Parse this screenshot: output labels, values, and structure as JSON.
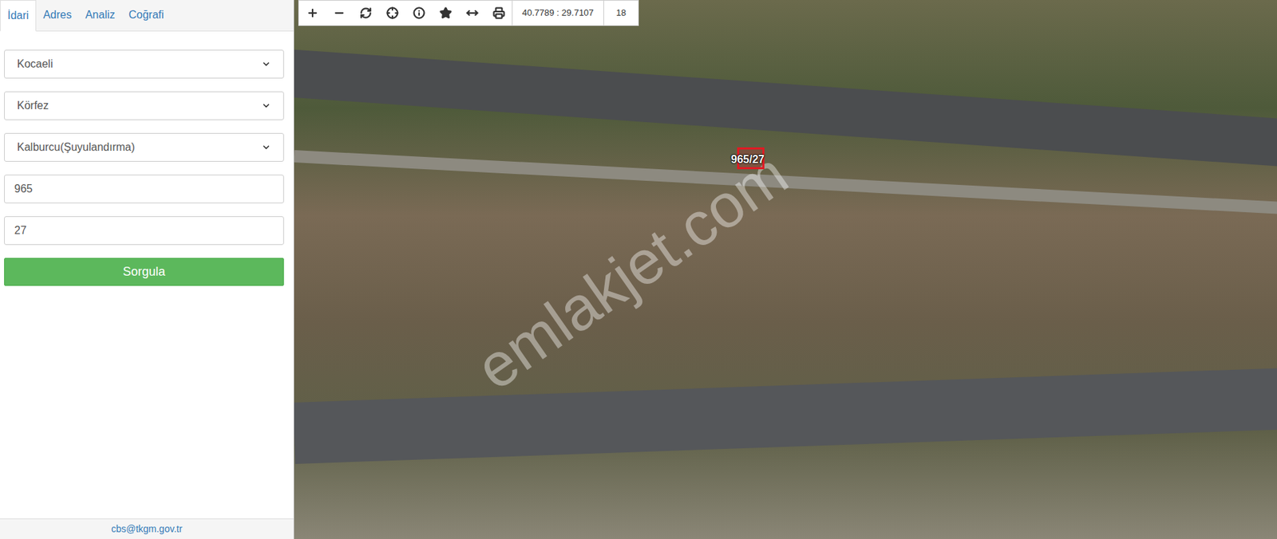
{
  "tabs": [
    {
      "label": "İdari",
      "selected": true
    },
    {
      "label": "Adres",
      "selected": false
    },
    {
      "label": "Analiz",
      "selected": false
    },
    {
      "label": "Coğrafi",
      "selected": false
    }
  ],
  "form": {
    "fields": [
      {
        "kind": "select",
        "value": "Kocaeli"
      },
      {
        "kind": "select",
        "value": "Körfez"
      },
      {
        "kind": "select",
        "value": "Kalburcu(Şuyulandırma)"
      },
      {
        "kind": "input",
        "value": "965"
      },
      {
        "kind": "input",
        "value": "27"
      }
    ],
    "submit": "Sorgula"
  },
  "footer": {
    "email": "cbs@tkgm.gov.tr"
  },
  "toolbar": {
    "coordinates": "40.7789 : 29.7107",
    "zoom": "18"
  },
  "map": {
    "parcel_label": "965/27",
    "watermark": "emlakjet.com"
  }
}
